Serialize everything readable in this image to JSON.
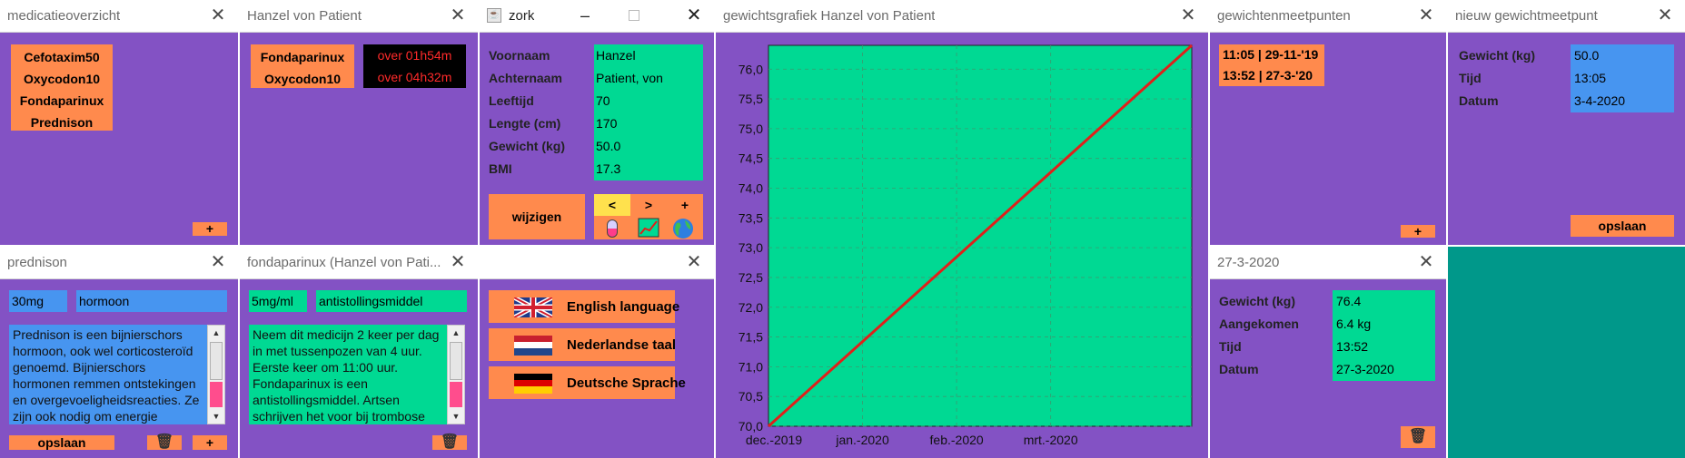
{
  "medicatieoverzicht": {
    "title": "medicatieoverzicht",
    "meds": [
      "Cefotaxim50",
      "Oxycodon10",
      "Fondaparinux",
      "Prednison"
    ],
    "add": "+"
  },
  "hanzel_meds": {
    "title": "Hanzel von Patient",
    "meds": [
      "Fondaparinux",
      "Oxycodon10"
    ],
    "times": [
      "over 01h54m",
      "over 04h32m"
    ]
  },
  "zork": {
    "title": "zork",
    "fields": [
      {
        "label": "Voornaam",
        "value": "Hanzel"
      },
      {
        "label": "Achternaam",
        "value": "Patient, von"
      },
      {
        "label": "Leeftijd",
        "value": "70"
      },
      {
        "label": "Lengte (cm)",
        "value": "170"
      },
      {
        "label": "Gewicht (kg)",
        "value": "50.0"
      },
      {
        "label": "BMI",
        "value": "17.3"
      }
    ],
    "edit": "wijzigen",
    "nav": {
      "prev": "<",
      "next": ">",
      "add": "+"
    },
    "icons": [
      "pill-icon",
      "chart-icon",
      "globe-icon"
    ]
  },
  "graph": {
    "title": "gewichtsgrafiek Hanzel von Patient"
  },
  "chart_data": {
    "type": "line",
    "xlabels": [
      "dec.-2019",
      "jan.-2020",
      "feb.-2020",
      "mrt.-2020"
    ],
    "y_ticks": [
      "70,0",
      "70,5",
      "71,0",
      "71,5",
      "72,0",
      "72,5",
      "73,0",
      "73,5",
      "74,0",
      "74,5",
      "75,0",
      "75,5",
      "76,0"
    ],
    "ylim": [
      70.0,
      76.4
    ],
    "series": [
      {
        "values": [
          70.0,
          76.4
        ]
      }
    ],
    "grid": true,
    "colors": {
      "plot_bg": "#00d993",
      "line": "#e0201a"
    }
  },
  "meetpunten": {
    "title": "gewichtenmeetpunten",
    "items": [
      "11:05 | 29-11-'19",
      "13:52 | 27-3-'20"
    ],
    "add": "+"
  },
  "nieuw": {
    "title": "nieuw gewichtmeetpunt",
    "fields": [
      {
        "label": "Gewicht (kg)",
        "value": "50.0"
      },
      {
        "label": "Tijd",
        "value": "13:05"
      },
      {
        "label": "Datum",
        "value": "3-4-2020"
      }
    ],
    "save": "opslaan"
  },
  "prednison": {
    "title": "prednison",
    "dose": "30mg",
    "category": "hormoon",
    "description": "Prednison is een bijnierschors hormoon, ook wel corticosteroïd genoemd. Bijnierschors hormonen remmen ontstekingen en overgevoeligheidsreacties. Ze zijn ook nodig om energie",
    "save": "opslaan",
    "add": "+"
  },
  "fondaparinux": {
    "title": "fondaparinux (Hanzel von Pati...",
    "dose": "5mg/ml",
    "category": "antistollingsmiddel",
    "description": "Neem dit medicijn 2 keer per dag in met tussenpozen van 4 uur. Eerste keer om 11:00 uur. Fondaparinux is een antistollingsmiddel. Artsen schrijven het voor bij trombose"
  },
  "languages": {
    "title": "",
    "items": [
      "English language",
      "Nederlandse taal",
      "Deutsche Sprache"
    ]
  },
  "datum": {
    "title": "27-3-2020",
    "fields": [
      {
        "label": "Gewicht (kg)",
        "value": "76.4"
      },
      {
        "label": "Aangekomen",
        "value": "6.4 kg"
      },
      {
        "label": "Tijd",
        "value": "13:52"
      },
      {
        "label": "Datum",
        "value": "27-3-2020"
      }
    ]
  }
}
